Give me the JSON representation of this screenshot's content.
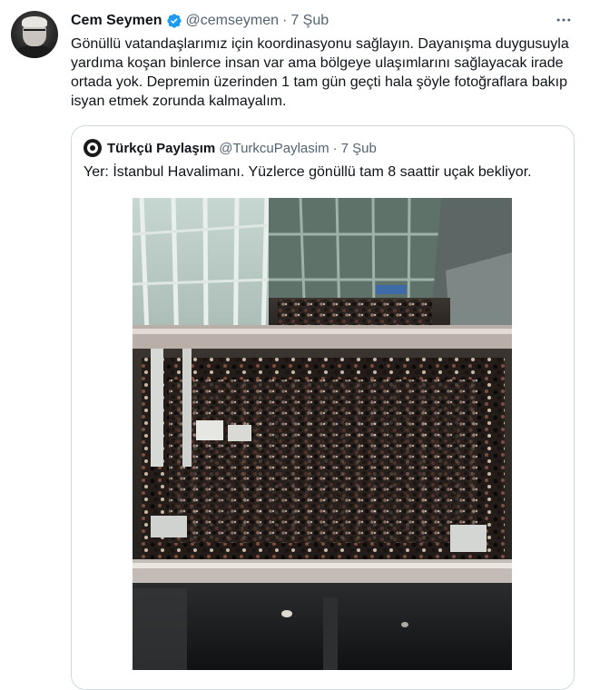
{
  "tweet": {
    "author_name": "Cem Seymen",
    "handle": "@cemseymen",
    "separator": "·",
    "date": "7 Şub",
    "more_icon": "more-horizontal-icon",
    "verified_color": "#1d9bf0",
    "text": "Gönüllü vatandaşlarımız için koordinasyonu sağlayın. Dayanışma duygusuyla yardıma koşan binlerce insan var ama bölgeye ulaşımlarını sağlayacak irade ortada yok. Depremin üzerinden 1 tam gün geçti hala şöyle fotoğraflara bakıp isyan etmek zorunda kalmayalım."
  },
  "quoted": {
    "author_name": "Türkçü Paylaşım",
    "handle": "@TurkcuPaylasim",
    "separator": "·",
    "date": "7 Şub",
    "text": "Yer: İstanbul Havalimanı. Yüzlerce gönüllü tam 8 saattir uçak bekliyor."
  }
}
